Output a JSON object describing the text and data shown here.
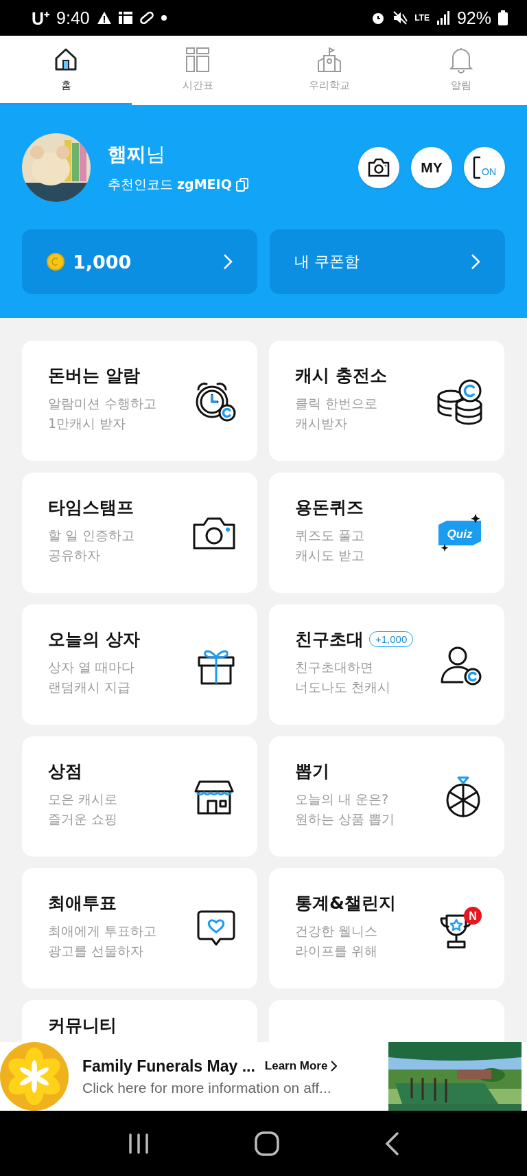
{
  "status_bar": {
    "carrier": "U⁺",
    "time": "9:40",
    "network": "LTE",
    "battery": "92%"
  },
  "tabs": [
    {
      "label": "홈",
      "selected": true
    },
    {
      "label": "시간표",
      "selected": false
    },
    {
      "label": "우리학교",
      "selected": false
    },
    {
      "label": "알림",
      "selected": false
    }
  ],
  "profile": {
    "name": "햄찌",
    "suffix": "님",
    "referral_label": "추천인코드",
    "referral_code": "zgMEIQ"
  },
  "header_buttons": [
    {
      "kind": "camera"
    },
    {
      "kind": "text",
      "label": "MY"
    },
    {
      "kind": "phone",
      "label": "ON"
    }
  ],
  "balance": {
    "amount": "1,000"
  },
  "coupon": {
    "label": "내 쿠폰함"
  },
  "menu": [
    {
      "kind": "feature",
      "title": "돈버는 알람",
      "description": "알람미션 수행하고\n1만캐시 받자"
    },
    {
      "kind": "feature",
      "title": "캐시 충전소",
      "description": "클릭 한번으로\n캐시받자"
    },
    {
      "kind": "feature",
      "title": "타임스탬프",
      "description": "할 일 인증하고\n공유하자"
    },
    {
      "kind": "feature",
      "title": "용돈퀴즈",
      "description": "퀴즈도 풀고\n캐시도 받고",
      "icon_text": "Quiz"
    },
    {
      "kind": "feature",
      "title": "오늘의 상자",
      "description": "상자 열 때마다\n랜덤캐시 지급"
    },
    {
      "kind": "feature",
      "title": "친구초대",
      "badge": "+1,000",
      "description": "친구초대하면\n너도나도 천캐시"
    },
    {
      "kind": "feature",
      "title": "상점",
      "description": "모은 캐시로\n즐거운 쇼핑"
    },
    {
      "kind": "feature",
      "title": "뽑기",
      "description": "오늘의 내 운은?\n원하는 상품 뽑기"
    },
    {
      "kind": "feature",
      "title": "최애투표",
      "description": "최애에게 투표하고\n광고를 선물하자"
    },
    {
      "kind": "feature",
      "title": "통계&챌린지",
      "description": "건강한 웰니스\n라이프를 위해",
      "icon_badge": "N"
    },
    {
      "kind": "feature",
      "title": "커뮤니티"
    },
    {
      "kind": "empty"
    }
  ],
  "ad": {
    "title": "Family Funerals May ...",
    "text": "Click here for more information on aff...",
    "action": "Learn More"
  }
}
